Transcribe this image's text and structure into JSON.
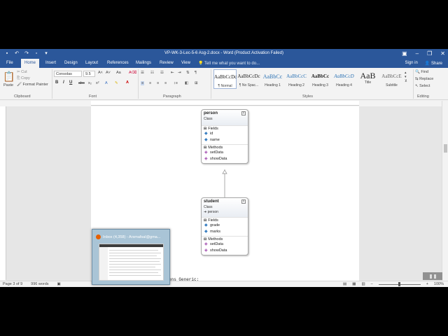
{
  "window": {
    "title": "VP-WK-3-Lec-5-6 Asg-2.docx - Word (Product Activation Failed)",
    "accent": "#2b579a"
  },
  "tabs": [
    "File",
    "Home",
    "Insert",
    "Design",
    "Layout",
    "References",
    "Mailings",
    "Review",
    "View"
  ],
  "active_tab": "Home",
  "tell_me": "Tell me what you want to do...",
  "account": {
    "sign_in": "Sign in",
    "share": "Share"
  },
  "clipboard": {
    "paste": "Paste",
    "cut": "Cut",
    "copy": "Copy",
    "format_painter": "Format Painter",
    "label": "Clipboard"
  },
  "font": {
    "name": "Consolas",
    "size": "9.5",
    "label": "Font"
  },
  "paragraph": {
    "label": "Paragraph"
  },
  "styles": {
    "label": "Styles",
    "items": [
      {
        "sample": "AaBbCcDc",
        "name": "¶ Normal"
      },
      {
        "sample": "AaBbCcDc",
        "name": "¶ No Spac..."
      },
      {
        "sample": "AaBbCc",
        "name": "Heading 1"
      },
      {
        "sample": "AaBbCcC",
        "name": "Heading 2"
      },
      {
        "sample": "AaBbCc",
        "name": "Heading 3"
      },
      {
        "sample": "AaBbCcD",
        "name": "Heading 4"
      },
      {
        "sample": "AaB",
        "name": "Title"
      },
      {
        "sample": "AaBbCcE",
        "name": "Subtitle"
      }
    ]
  },
  "editing": {
    "find": "Find",
    "replace": "Replace",
    "select": "Select",
    "label": "Editing"
  },
  "diagram": {
    "person": {
      "name": "person",
      "type": "Class",
      "fields_label": "Fields",
      "fields": [
        "id",
        "name"
      ],
      "methods_label": "Methods",
      "methods": [
        "setData",
        "showData"
      ]
    },
    "student": {
      "name": "student",
      "type": "Class",
      "base": "person",
      "fields_label": "Fields",
      "fields": [
        "grade",
        "marks"
      ],
      "methods_label": "Methods",
      "methods": [
        "setData",
        "showData"
      ]
    }
  },
  "doc_text": "ons Generic:",
  "status": {
    "page": "Page 3 of 9",
    "words": "996 words",
    "zoom": "100%"
  },
  "taskbar_thumb": {
    "title": "Inbox (4,358) - Arsmafsal@gma..."
  }
}
